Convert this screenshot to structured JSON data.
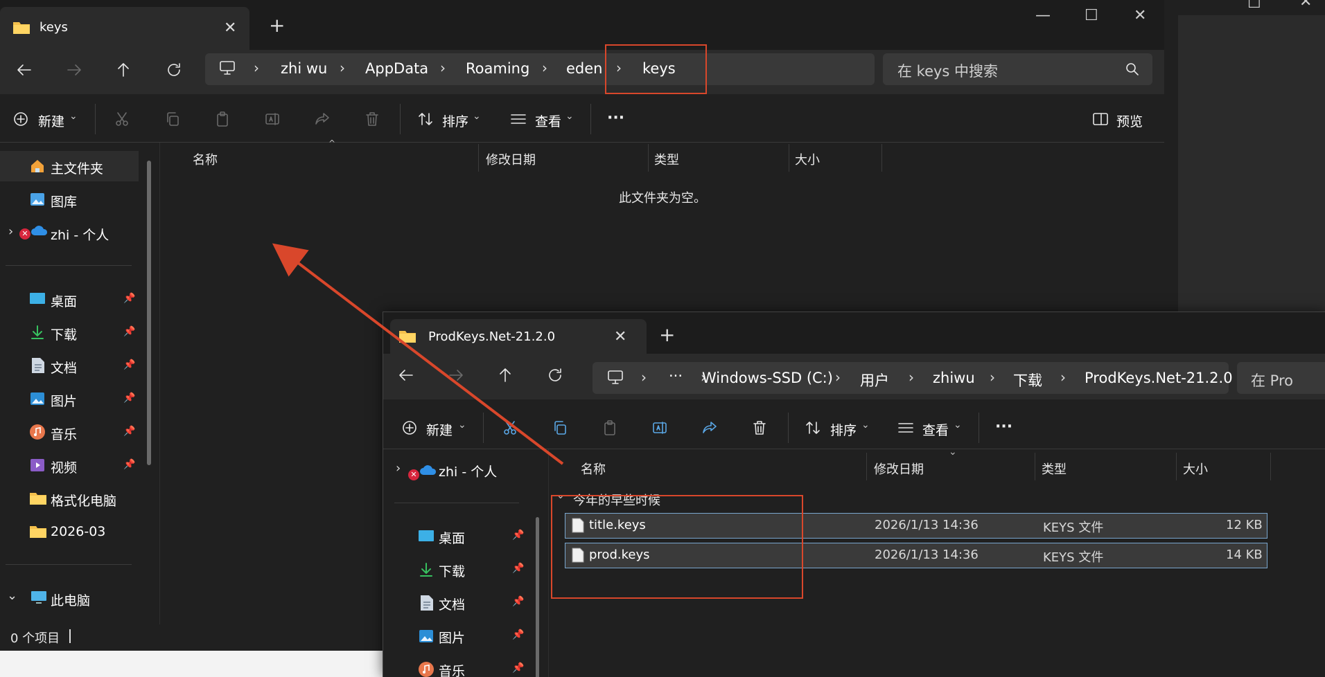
{
  "window1": {
    "tab_title": "keys",
    "breadcrumb": [
      "zhi wu",
      "AppData",
      "Roaming",
      "eden",
      "keys"
    ],
    "search_placeholder": "在 keys 中搜索",
    "toolbar": {
      "new_label": "新建",
      "sort_label": "排序",
      "view_label": "查看",
      "more_label": "···",
      "preview_label": "预览"
    },
    "columns": {
      "name": "名称",
      "modified": "修改日期",
      "type": "类型",
      "size": "大小"
    },
    "empty_message": "此文件夹为空。",
    "sidebar": {
      "home": "主文件夹",
      "gallery": "图库",
      "onedrive": "zhi - 个人",
      "quick_access": [
        {
          "label": "桌面",
          "icon": "desktop-icon"
        },
        {
          "label": "下载",
          "icon": "download-icon"
        },
        {
          "label": "文档",
          "icon": "document-icon"
        },
        {
          "label": "图片",
          "icon": "pictures-icon"
        },
        {
          "label": "音乐",
          "icon": "music-icon"
        },
        {
          "label": "视频",
          "icon": "video-icon"
        },
        {
          "label": "格式化电脑",
          "icon": "folder-icon"
        },
        {
          "label": "2026-03",
          "icon": "folder-icon"
        }
      ],
      "this_pc": "此电脑"
    },
    "status": "0 个项目"
  },
  "window2": {
    "tab_title": "ProdKeys.Net-21.2.0",
    "breadcrumb": [
      "Windows-SSD (C:)",
      "用户",
      "zhiwu",
      "下载",
      "ProdKeys.Net-21.2.0"
    ],
    "overflow_label": "···",
    "search_placeholder": "在 Pro",
    "toolbar": {
      "new_label": "新建",
      "sort_label": "排序",
      "view_label": "查看",
      "more_label": "···"
    },
    "columns": {
      "name": "名称",
      "modified": "修改日期",
      "type": "类型",
      "size": "大小"
    },
    "group_header": "今年的早些时候",
    "files": [
      {
        "name": "title.keys",
        "modified": "2026/1/13 14:36",
        "type": "KEYS 文件",
        "size": "12 KB"
      },
      {
        "name": "prod.keys",
        "modified": "2026/1/13 14:36",
        "type": "KEYS 文件",
        "size": "14 KB"
      }
    ],
    "sidebar": {
      "onedrive": "zhi - 个人",
      "quick_access": [
        {
          "label": "桌面",
          "icon": "desktop-icon"
        },
        {
          "label": "下载",
          "icon": "download-icon"
        },
        {
          "label": "文档",
          "icon": "document-icon"
        },
        {
          "label": "图片",
          "icon": "pictures-icon"
        },
        {
          "label": "音乐",
          "icon": "music-icon"
        }
      ]
    }
  },
  "colors": {
    "annotation": "#d9472b",
    "folder": "#f4c04c",
    "selection_border": "#7aa7cf"
  }
}
